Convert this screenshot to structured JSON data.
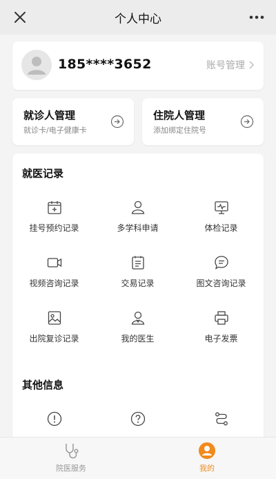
{
  "header": {
    "title": "个人中心"
  },
  "profile": {
    "phone": "185****3652",
    "account_label": "账号管理"
  },
  "managers": [
    {
      "title": "就诊人管理",
      "subtitle": "就诊卡/电子健康卡"
    },
    {
      "title": "住院人管理",
      "subtitle": "添加绑定住院号"
    }
  ],
  "medical_records": {
    "title": "就医记录",
    "items": [
      {
        "label": "挂号预约记录",
        "icon": "calendar-plus-icon"
      },
      {
        "label": "多学科申请",
        "icon": "users-icon"
      },
      {
        "label": "体检记录",
        "icon": "monitor-pulse-icon"
      },
      {
        "label": "视频咨询记录",
        "icon": "video-camera-icon"
      },
      {
        "label": "交易记录",
        "icon": "receipt-icon"
      },
      {
        "label": "图文咨询记录",
        "icon": "chat-bubble-icon"
      },
      {
        "label": "出院复诊记录",
        "icon": "image-document-icon"
      },
      {
        "label": "我的医生",
        "icon": "doctor-icon"
      },
      {
        "label": "电子发票",
        "icon": "printer-icon"
      }
    ]
  },
  "other_info": {
    "title": "其他信息",
    "icons": [
      "info-circle-icon",
      "question-circle-icon",
      "route-icon"
    ]
  },
  "tabbar": {
    "tabs": [
      {
        "label": "院医服务",
        "icon": "stethoscope-icon",
        "active": false
      },
      {
        "label": "我的",
        "icon": "user-icon",
        "active": true
      }
    ],
    "active_color": "#f28a1c",
    "inactive_color": "#999999"
  }
}
